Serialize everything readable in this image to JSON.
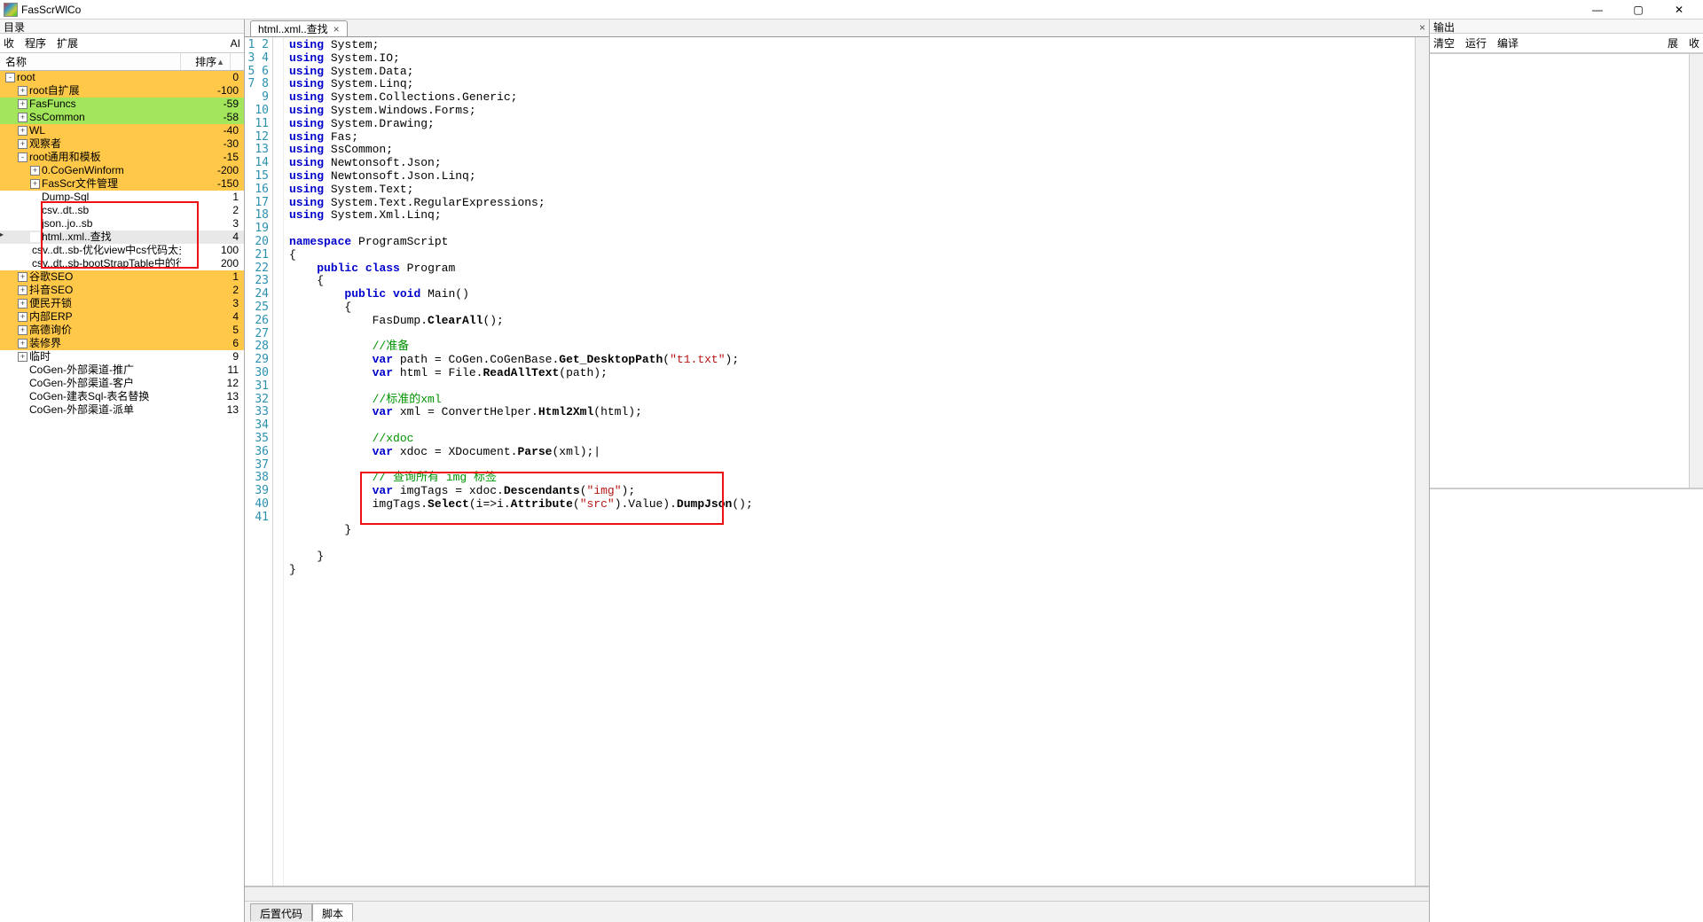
{
  "app": {
    "title": "FasScrWlCo",
    "win_buttons": {
      "min": "—",
      "max": "▢",
      "close": "✕"
    }
  },
  "left": {
    "header": "目录",
    "toolbar": {
      "collapse": "收",
      "program": "程序",
      "ext": "扩展",
      "ai": "AI"
    },
    "columns": {
      "name": "名称",
      "sort": "排序",
      "arrow": "▲"
    },
    "rows": [
      {
        "d": 0,
        "e": "-",
        "n": "root",
        "v": "0",
        "c": "y"
      },
      {
        "d": 1,
        "e": "+",
        "n": "root自扩展",
        "v": "-100",
        "c": "y"
      },
      {
        "d": 1,
        "e": "+",
        "n": "FasFuncs",
        "v": "-59",
        "c": "g"
      },
      {
        "d": 1,
        "e": "+",
        "n": "SsCommon",
        "v": "-58",
        "c": "g"
      },
      {
        "d": 1,
        "e": "+",
        "n": "WL",
        "v": "-40",
        "c": "y"
      },
      {
        "d": 1,
        "e": "+",
        "n": "观察者",
        "v": "-30",
        "c": "y"
      },
      {
        "d": 1,
        "e": "-",
        "n": "root通用和模板",
        "v": "-15",
        "c": "y"
      },
      {
        "d": 2,
        "e": "+",
        "n": "0.CoGenWinform",
        "v": "-200",
        "c": "y"
      },
      {
        "d": 2,
        "e": "+",
        "n": "FasScr文件管理",
        "v": "-150",
        "c": "y"
      },
      {
        "d": 2,
        "e": " ",
        "n": "Dump-Sql",
        "v": "1",
        "c": ""
      },
      {
        "d": 2,
        "e": " ",
        "n": "csv..dt..sb",
        "v": "2",
        "c": ""
      },
      {
        "d": 2,
        "e": " ",
        "n": "json..jo..sb",
        "v": "3",
        "c": ""
      },
      {
        "d": 2,
        "e": " ",
        "n": "html..xml..查找",
        "v": "4",
        "c": "sel"
      },
      {
        "d": 2,
        "e": " ",
        "n": "csv..dt..sb-优化view中cs代码太多",
        "v": "100",
        "c": ""
      },
      {
        "d": 2,
        "e": " ",
        "n": "csv..dt..sb-bootStrapTable中的行",
        "v": "200",
        "c": ""
      },
      {
        "d": 1,
        "e": "+",
        "n": "谷歌SEO",
        "v": "1",
        "c": "y"
      },
      {
        "d": 1,
        "e": "+",
        "n": "抖音SEO",
        "v": "2",
        "c": "y"
      },
      {
        "d": 1,
        "e": "+",
        "n": "便民开锁",
        "v": "3",
        "c": "y"
      },
      {
        "d": 1,
        "e": "+",
        "n": "内部ERP",
        "v": "4",
        "c": "y"
      },
      {
        "d": 1,
        "e": "+",
        "n": "高德询价",
        "v": "5",
        "c": "y"
      },
      {
        "d": 1,
        "e": "+",
        "n": "装修界",
        "v": "6",
        "c": "y"
      },
      {
        "d": 1,
        "e": "+",
        "n": "临时",
        "v": "9",
        "c": ""
      },
      {
        "d": 1,
        "e": " ",
        "n": "CoGen-外部渠道-推广",
        "v": "11",
        "c": ""
      },
      {
        "d": 1,
        "e": " ",
        "n": "CoGen-外部渠道-客户",
        "v": "12",
        "c": ""
      },
      {
        "d": 1,
        "e": " ",
        "n": "CoGen-建表Sql-表名替换",
        "v": "13",
        "c": ""
      },
      {
        "d": 1,
        "e": " ",
        "n": "CoGen-外部渠道-派单",
        "v": "13",
        "c": ""
      }
    ]
  },
  "editor": {
    "tab_label": "html..xml..查找",
    "tabs_bottom": {
      "back": "后置代码",
      "script": "脚本"
    },
    "lines": 41,
    "code_html": "<span class='kw'>using</span> System;\n<span class='kw'>using</span> System.IO;\n<span class='kw'>using</span> System.Data;\n<span class='kw'>using</span> System.Linq;\n<span class='kw'>using</span> System.Collections.Generic;\n<span class='kw'>using</span> System.Windows.Forms;\n<span class='kw'>using</span> System.Drawing;\n<span class='kw'>using</span> Fas;\n<span class='kw'>using</span> SsCommon;\n<span class='kw'>using</span> Newtonsoft.Json;\n<span class='kw'>using</span> Newtonsoft.Json.Linq;\n<span class='kw'>using</span> System.Text;\n<span class='kw'>using</span> System.Text.RegularExpressions;\n<span class='kw'>using</span> System.Xml.Linq;\n\n<span class='kw'>namespace</span> ProgramScript\n{\n    <span class='kw'>public</span> <span class='kw'>class</span> Program\n    {\n        <span class='kw'>public</span> <span class='kw'>void</span> Main()\n        {\n            FasDump.<span class='boldcall'>ClearAll</span>();\n\n            <span class='cm'>//准备</span>\n            <span class='kw'>var</span> path = CoGen.CoGenBase.<span class='boldcall'>Get_DesktopPath</span>(<span class='str'>\"t1.txt\"</span>);\n            <span class='kw'>var</span> html = File.<span class='boldcall'>ReadAllText</span>(path);\n\n            <span class='cm'>//标准的xml</span>\n            <span class='kw'>var</span> xml = ConvertHelper.<span class='boldcall'>Html2Xml</span>(html);\n\n            <span class='cm'>//xdoc</span>\n            <span class='kw'>var</span> xdoc = XDocument.<span class='boldcall'>Parse</span>(xml);|\n\n            <span class='cm'>// 查询所有 img 标签</span>\n            <span class='kw'>var</span> imgTags = xdoc.<span class='boldcall'>Descendants</span>(<span class='str'>\"img\"</span>);\n            imgTags.<span class='boldcall'>Select</span>(i=>i.<span class='boldcall'>Attribute</span>(<span class='str'>\"src\"</span>).Value).<span class='boldcall'>DumpJson</span>();\n\n        }\n\n    }\n}"
  },
  "right": {
    "header": "输出",
    "toolbar": {
      "clear": "清空",
      "run": "运行",
      "compile": "编译",
      "expand": "展",
      "collapse": "收"
    }
  }
}
